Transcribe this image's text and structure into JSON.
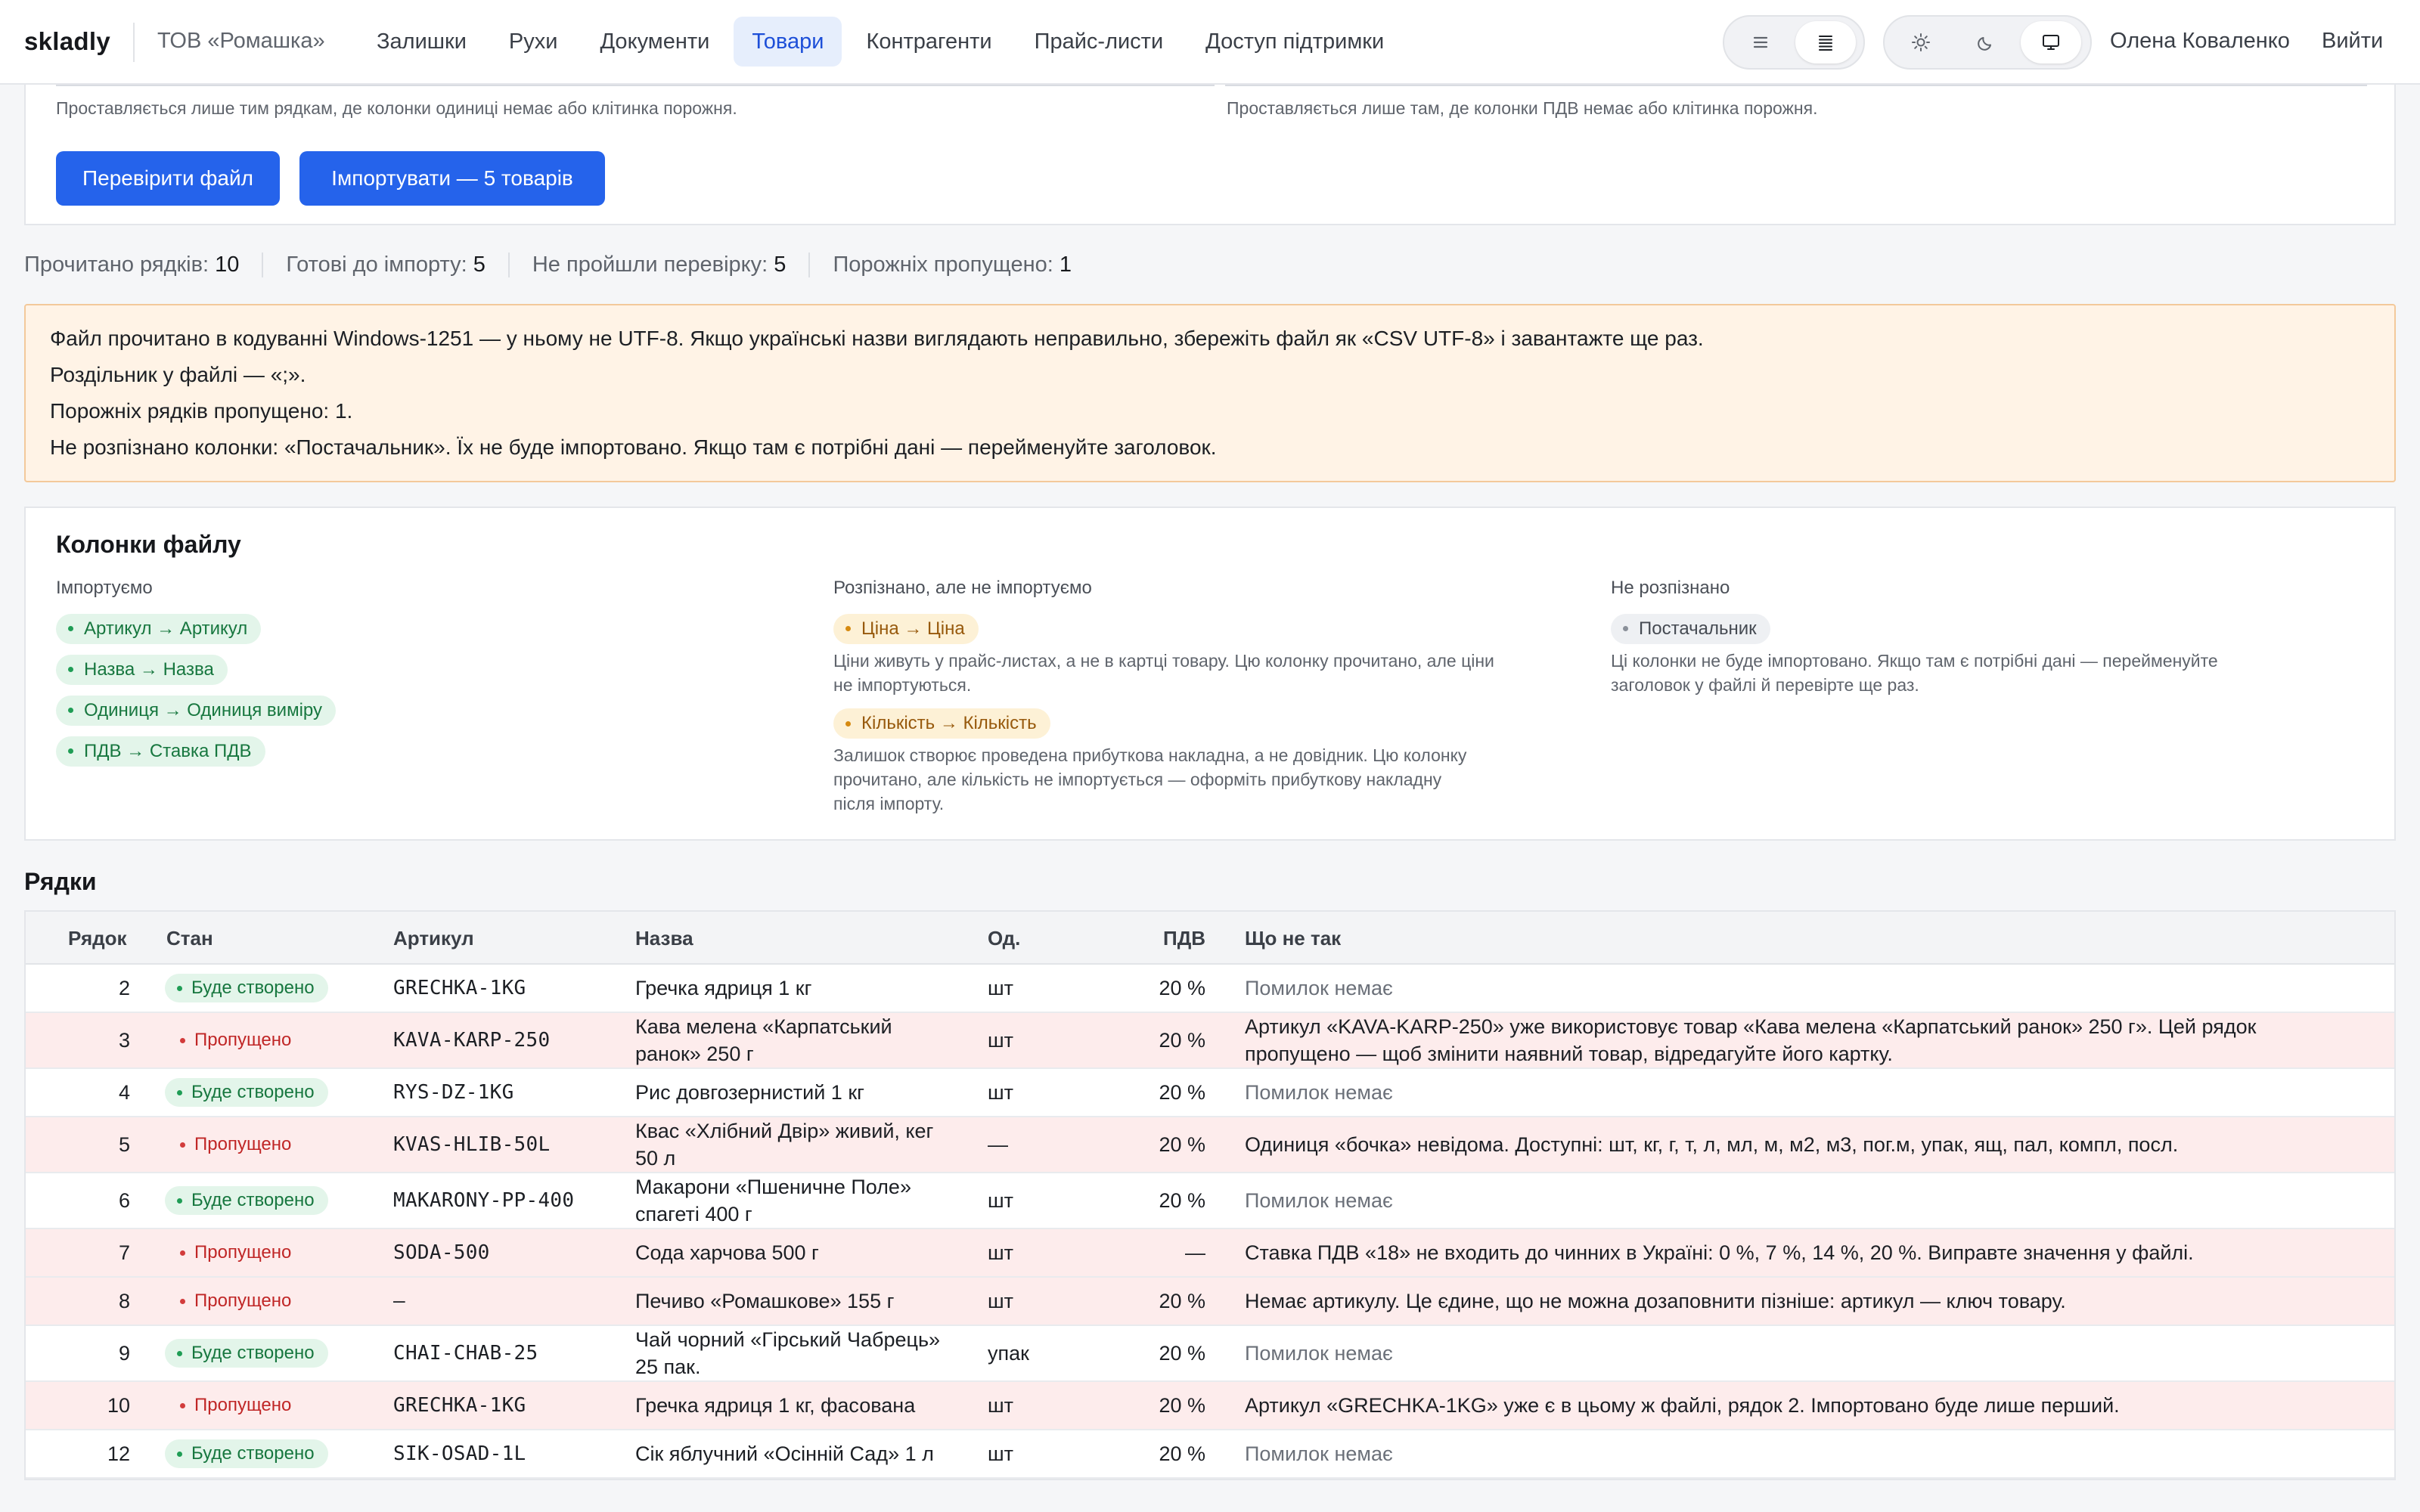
{
  "header": {
    "brand": "skladly",
    "company": "ТОВ «Ромашка»",
    "nav": [
      "Залишки",
      "Рухи",
      "Документи",
      "Товари",
      "Контрагенти",
      "Прайс-листи",
      "Доступ підтримки"
    ],
    "nav_active_index": 3,
    "user": "Олена Коваленко",
    "logout": "Вийти",
    "density_icons": [
      "list-comfortable-icon",
      "list-compact-icon"
    ],
    "theme_icons": [
      "sun-icon",
      "moon-icon",
      "monitor-icon"
    ]
  },
  "form": {
    "hint_left": "Проставляється лише тим рядкам, де колонки одиниці немає або клітинка порожня.",
    "hint_right": "Проставляється лише там, де колонки ПДВ немає або клітинка порожня.",
    "check_button": "Перевірити файл",
    "import_button": "Імпортувати — 5 товарів"
  },
  "stats": [
    {
      "label": "Прочитано рядків:",
      "value": "10"
    },
    {
      "label": "Готові до імпорту:",
      "value": "5"
    },
    {
      "label": "Не пройшли перевірку:",
      "value": "5"
    },
    {
      "label": "Порожніх пропущено:",
      "value": "1"
    }
  ],
  "warnings": [
    "Файл прочитано в кодуванні Windows-1251 — у ньому не UTF-8. Якщо українські назви виглядають неправильно, збережіть файл як «CSV UTF-8» і завантажте ще раз.",
    "Роздільник у файлі — «;».",
    "Порожніх рядків пропущено: 1.",
    "Не розпізнано колонки: «Постачальник». Їх не буде імпортовано. Якщо там є потрібні дані — перейменуйте заголовок."
  ],
  "columns": {
    "title": "Колонки файлу",
    "imported": {
      "heading": "Імпортуємо",
      "chips": [
        "Артикул → Артикул",
        "Назва → Назва",
        "Одиниця → Одиниця виміру",
        "ПДВ → Ставка ПДВ"
      ]
    },
    "recognized": {
      "heading": "Розпізнано, але не імпортуємо",
      "items": [
        {
          "chip": "Ціна → Ціна",
          "note": "Ціни живуть у прайс-листах, а не в картці товару. Цю колонку прочитано, але ціни\nне імпортуються."
        },
        {
          "chip": "Кількість → Кількість",
          "note": "Залишок створює проведена прибуткова накладна, а не довідник. Цю колонку\nпрочитано, але кількість не імпортується — оформіть прибуткову накладну\nпісля імпорту."
        }
      ]
    },
    "unrecognized": {
      "heading": "Не розпізнано",
      "chip": "Постачальник",
      "note": "Ці колонки не буде імпортовано. Якщо там є потрібні дані — перейменуйте\nзаголовок у файлі й перевірте ще раз."
    }
  },
  "rows": {
    "title": "Рядки",
    "headers": [
      "Рядок",
      "Стан",
      "Артикул",
      "Назва",
      "Од.",
      "ПДВ",
      "Що не так"
    ],
    "items": [
      {
        "row": "2",
        "status": "Буде створено",
        "ok": true,
        "sku": "GRECHKA-1KG",
        "name": "Гречка ядриця 1 кг",
        "unit": "шт",
        "vat": "20 %",
        "issue": "Помилок немає"
      },
      {
        "row": "3",
        "status": "Пропущено",
        "ok": false,
        "sku": "KAVA-KARP-250",
        "name": "Кава мелена «Карпатський\nранок» 250 г",
        "unit": "шт",
        "vat": "20 %",
        "issue": "Артикул «KAVA-KARP-250» уже використовує товар «Кава мелена «Карпатський ранок» 250 г». Цей рядок\nпропущено — щоб змінити наявний товар, відредагуйте його картку."
      },
      {
        "row": "4",
        "status": "Буде створено",
        "ok": true,
        "sku": "RYS-DZ-1KG",
        "name": "Рис довгозернистий 1 кг",
        "unit": "шт",
        "vat": "20 %",
        "issue": "Помилок немає"
      },
      {
        "row": "5",
        "status": "Пропущено",
        "ok": false,
        "sku": "KVAS-HLIB-50L",
        "name": "Квас «Хлібний Двір» живий, кег\n50 л",
        "unit": "—",
        "vat": "20 %",
        "issue": "Одиниця «бочка» невідома. Доступні: шт, кг, г, т, л, мл, м, м2, м3, пог.м, упак, ящ, пал, компл, посл."
      },
      {
        "row": "6",
        "status": "Буде створено",
        "ok": true,
        "sku": "MAKARONY-PP-400",
        "name": "Макарони «Пшеничне Поле»\nспагеті 400 г",
        "unit": "шт",
        "vat": "20 %",
        "issue": "Помилок немає"
      },
      {
        "row": "7",
        "status": "Пропущено",
        "ok": false,
        "sku": "SODA-500",
        "name": "Сода харчова 500 г",
        "unit": "шт",
        "vat": "—",
        "issue": "Ставка ПДВ «18» не входить до чинних в Україні: 0 %, 7 %, 14 %, 20 %. Виправте значення у файлі."
      },
      {
        "row": "8",
        "status": "Пропущено",
        "ok": false,
        "sku": "—",
        "name": "Печиво «Ромашкове» 155 г",
        "unit": "шт",
        "vat": "20 %",
        "issue": "Немає артикулу. Це єдине, що не можна дозаповнити пізніше: артикул — ключ товару."
      },
      {
        "row": "9",
        "status": "Буде створено",
        "ok": true,
        "sku": "CHAI-CHAB-25",
        "name": "Чай чорний «Гірський Чабрець»\n25 пак.",
        "unit": "упак",
        "vat": "20 %",
        "issue": "Помилок немає"
      },
      {
        "row": "10",
        "status": "Пропущено",
        "ok": false,
        "sku": "GRECHKA-1KG",
        "name": "Гречка ядриця 1 кг, фасована",
        "unit": "шт",
        "vat": "20 %",
        "issue": "Артикул «GRECHKA-1KG» уже є в цьому ж файлі, рядок 2. Імпортовано буде лише перший."
      },
      {
        "row": "12",
        "status": "Буде створено",
        "ok": true,
        "sku": "SIK-OSAD-1L",
        "name": "Сік яблучний «Осінній Сад» 1 л",
        "unit": "шт",
        "vat": "20 %",
        "issue": "Помилок немає"
      }
    ]
  }
}
